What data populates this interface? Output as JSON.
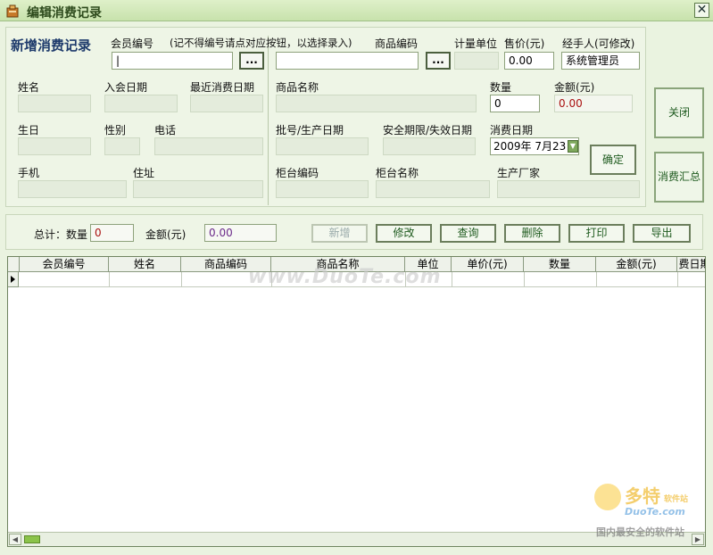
{
  "window": {
    "title": "编辑消费记录",
    "close_glyph": "✕"
  },
  "form": {
    "heading": "新增消费记录",
    "member_id_label": "会员编号",
    "member_hint": "(记不得编号请点对应按钮，以选择录入)",
    "member_id_value": "|",
    "browse_label": "...",
    "product_code_label": "商品编码",
    "unit_label": "计量单位",
    "price_label": "售价(元)",
    "price_value": "0.00",
    "handler_label": "经手人(可修改)",
    "handler_value": "系统管理员",
    "name_label": "姓名",
    "join_date_label": "入会日期",
    "last_date_label": "最近消费日期",
    "product_name_label": "商品名称",
    "quantity_label": "数量",
    "quantity_value": "0",
    "amount_label": "金额(元)",
    "amount_value": "0.00",
    "birthday_label": "生日",
    "gender_label": "性别",
    "phone_label": "电话",
    "batch_label": "批号/生产日期",
    "expiry_label": "安全期限/失效日期",
    "consume_date_label": "消费日期",
    "consume_date_value": "2009年 7月23日",
    "confirm_label": "确定",
    "mobile_label": "手机",
    "address_label": "住址",
    "counter_code_label": "柜台编码",
    "counter_name_label": "柜台名称",
    "maker_label": "生产厂家"
  },
  "side": {
    "close_label": "关闭",
    "summary_label": "消费汇总"
  },
  "totals": {
    "total_qty_label": "总计：数量",
    "total_qty_value": "0",
    "total_amount_label": "金额(元)",
    "total_amount_value": "0.00"
  },
  "actions": {
    "new": "新增",
    "edit": "修改",
    "query": "查询",
    "delete": "删除",
    "print": "打印",
    "export": "导出"
  },
  "grid": {
    "columns": [
      "会员编号",
      "姓名",
      "商品编码",
      "商品名称",
      "单位",
      "单价(元)",
      "数量",
      "金额(元)",
      "费日期"
    ]
  },
  "watermarks": {
    "center": "www.DuoTe.com",
    "logo": "多特",
    "logo_sub": "软件站",
    "url": "DuoTe.com",
    "tagline": "国内最安全的软件站"
  },
  "colors": {
    "accent": "#1e5a1e",
    "heading": "#1d3a6b",
    "background": "#eaf3e0"
  }
}
